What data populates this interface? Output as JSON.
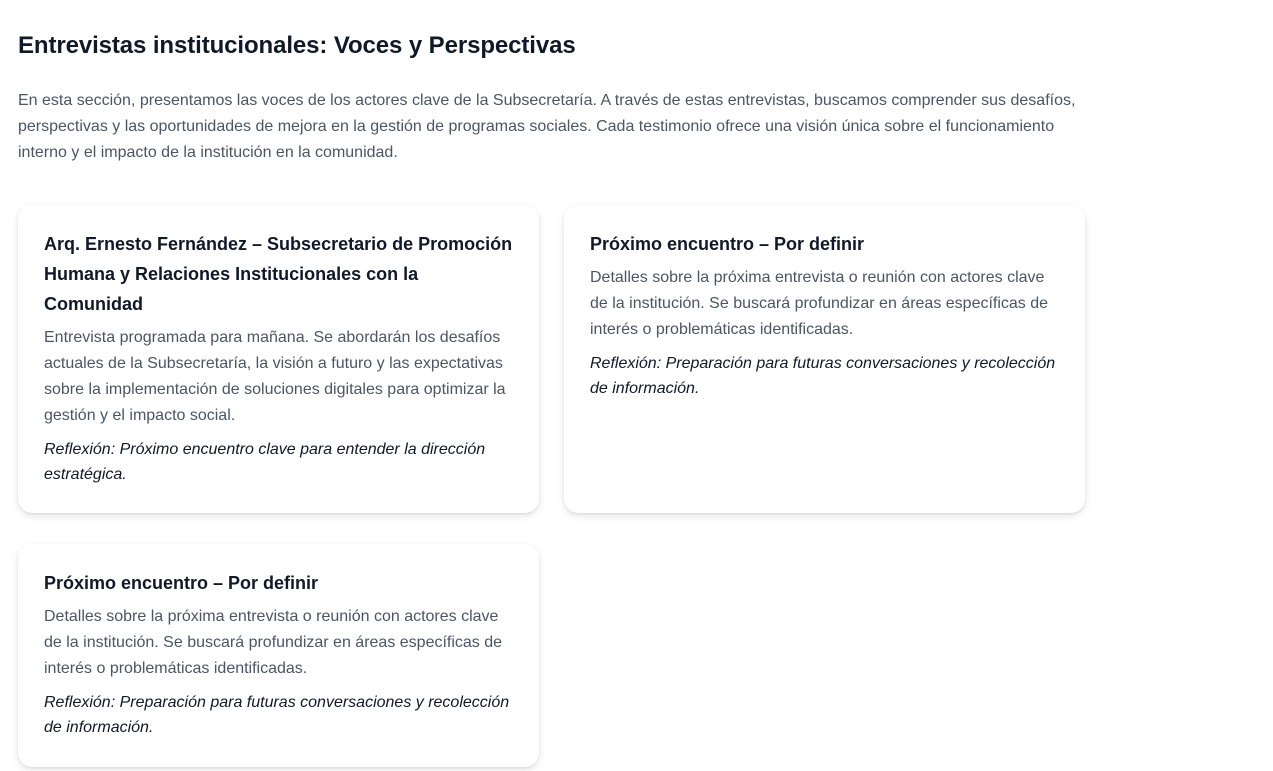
{
  "page": {
    "title": "Entrevistas institucionales: Voces y Perspectivas",
    "intro": "En esta sección, presentamos las voces de los actores clave de la Subsecretaría. A través de estas entrevistas, buscamos comprender sus desafíos, perspectivas y las oportunidades de mejora en la gestión de programas sociales. Cada testimonio ofrece una visión única sobre el funcionamiento interno y el impacto de la institución en la comunidad."
  },
  "cards": [
    {
      "title": "Arq. Ernesto Fernández – Subsecretario de Promoción Humana y Relaciones Institucionales con la Comunidad",
      "body": "Entrevista programada para mañana. Se abordarán los desafíos actuales de la Subsecretaría, la visión a futuro y las expectativas sobre la implementación de soluciones digitales para optimizar la gestión y el impacto social.",
      "reflection": "Reflexión: Próximo encuentro clave para entender la dirección estratégica."
    },
    {
      "title": "Próximo encuentro – Por definir",
      "body": "Detalles sobre la próxima entrevista o reunión con actores clave de la institución. Se buscará profundizar en áreas específicas de interés o problemáticas identificadas.",
      "reflection": "Reflexión: Preparación para futuras conversaciones y recolección de información."
    },
    {
      "title": "Próximo encuentro – Por definir",
      "body": "Detalles sobre la próxima entrevista o reunión con actores clave de la institución. Se buscará profundizar en áreas específicas de interés o problemáticas identificadas.",
      "reflection": "Reflexión: Preparación para futuras conversaciones y recolección de información."
    }
  ]
}
